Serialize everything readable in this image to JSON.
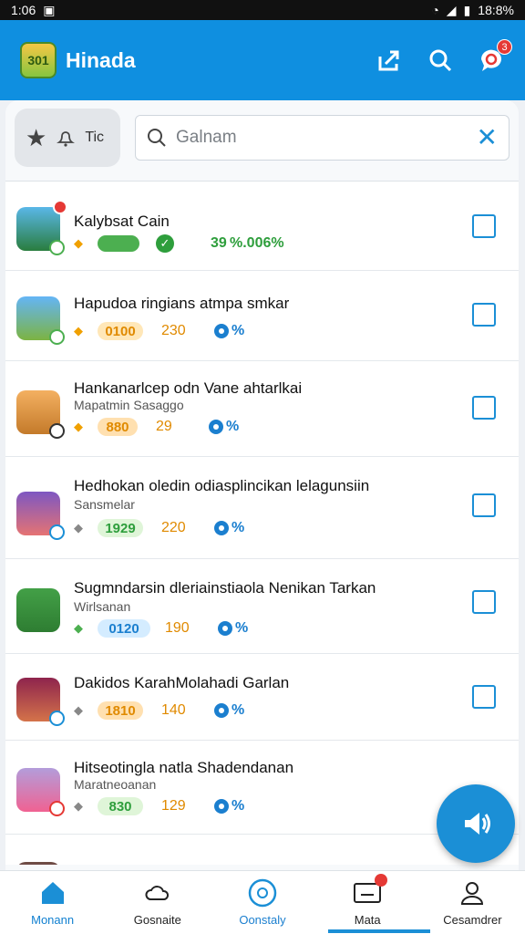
{
  "status": {
    "time": "1:06",
    "clock": "18:8%"
  },
  "app": {
    "title": "Hinada",
    "logo_text": "301",
    "notification_count": "3"
  },
  "filter": {
    "chip_label": "Tic",
    "search_placeholder": "Galnam"
  },
  "rows": [
    {
      "title": "Kalybsat Cain",
      "sub": "",
      "pill": "",
      "num": "",
      "pct": "39 %.006%",
      "pill_color": "#4caf50"
    },
    {
      "title": "Hapudoa ringians atmpa smkar",
      "sub": "",
      "pill": "0100",
      "num": "230",
      "pct": "%",
      "pill_color": "#ffe7b8"
    },
    {
      "title": "Hankanarlcep odn Vane ahtarlkai",
      "sub": "Mapatmin Sasaggo",
      "pill": "880",
      "num": "29",
      "pct": "%",
      "pill_color": "#ffe0b0"
    },
    {
      "title": "Hedhokan oledin odiasplincikan lelagunsiin",
      "sub": "Sansmelar",
      "pill": "1929",
      "num": "220",
      "pct": "%",
      "pill_color": "#dff5d8"
    },
    {
      "title": "Sugmndarsin dleriainstiaola Nenikan Tarkan",
      "sub": "Wirlsanan",
      "pill": "0120",
      "num": "190",
      "pct": "%",
      "pill_color": "#d4ecff"
    },
    {
      "title": "Dakidos KarahMolahadi Garlan",
      "sub": "",
      "pill": "1810",
      "num": "140",
      "pct": "%",
      "pill_color": "#ffe0b0"
    },
    {
      "title": "Hitseotingla natla Shadendanan",
      "sub": "Maratneoanan",
      "pill": "830",
      "num": "129",
      "pct": "%",
      "pill_color": "#dff5d8"
    }
  ],
  "nav": [
    {
      "label": "Monann"
    },
    {
      "label": "Gosnaite"
    },
    {
      "label": "Oonstaly"
    },
    {
      "label": "Mata"
    },
    {
      "label": "Cesamdrer"
    }
  ],
  "colors": {
    "primary": "#0f8fe0",
    "accent": "#1b8fd6",
    "alert": "#e53935"
  }
}
